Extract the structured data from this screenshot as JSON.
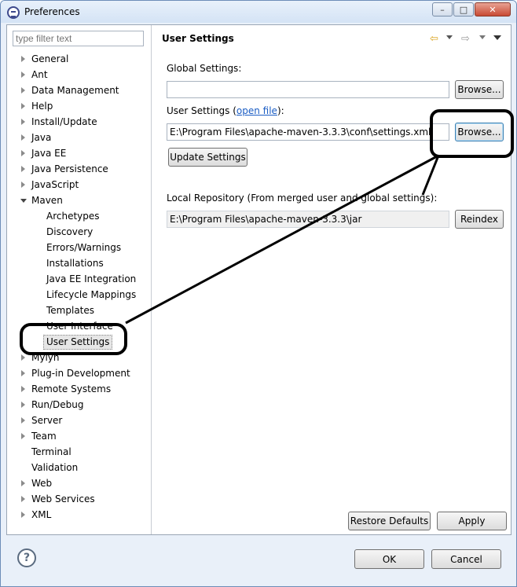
{
  "window": {
    "title": "Preferences",
    "min_glyph": "–",
    "max_glyph": "□",
    "close_glyph": "✕"
  },
  "filter": {
    "placeholder": "type filter text"
  },
  "tree": [
    {
      "label": "General",
      "expandable": true
    },
    {
      "label": "Ant",
      "expandable": true
    },
    {
      "label": "Data Management",
      "expandable": true
    },
    {
      "label": "Help",
      "expandable": true
    },
    {
      "label": "Install/Update",
      "expandable": true
    },
    {
      "label": "Java",
      "expandable": true
    },
    {
      "label": "Java EE",
      "expandable": true
    },
    {
      "label": "Java Persistence",
      "expandable": true
    },
    {
      "label": "JavaScript",
      "expandable": true
    },
    {
      "label": "Maven",
      "expandable": true,
      "expanded": true
    },
    {
      "label": "Archetypes",
      "child": true
    },
    {
      "label": "Discovery",
      "child": true
    },
    {
      "label": "Errors/Warnings",
      "child": true
    },
    {
      "label": "Installations",
      "child": true
    },
    {
      "label": "Java EE Integration",
      "child": true
    },
    {
      "label": "Lifecycle Mappings",
      "child": true
    },
    {
      "label": "Templates",
      "child": true
    },
    {
      "label": "User Interface",
      "child": true
    },
    {
      "label": "User Settings",
      "child": true,
      "selected": true
    },
    {
      "label": "Mylyn",
      "expandable": true
    },
    {
      "label": "Plug-in Development",
      "expandable": true
    },
    {
      "label": "Remote Systems",
      "expandable": true
    },
    {
      "label": "Run/Debug",
      "expandable": true
    },
    {
      "label": "Server",
      "expandable": true
    },
    {
      "label": "Team",
      "expandable": true
    },
    {
      "label": "Terminal",
      "expandable": false
    },
    {
      "label": "Validation",
      "expandable": false
    },
    {
      "label": "Web",
      "expandable": true
    },
    {
      "label": "Web Services",
      "expandable": true
    },
    {
      "label": "XML",
      "expandable": true
    }
  ],
  "page": {
    "title": "User Settings",
    "global_label": "Global Settings:",
    "global_value": "",
    "browse_label": "Browse...",
    "user_label_prefix": "User Settings (",
    "user_label_link": "open file",
    "user_label_suffix": "):",
    "user_value": "E:\\Program Files\\apache-maven-3.3.3\\conf\\settings.xml",
    "browse2_label": "Browse...",
    "update_label": "Update Settings",
    "local_repo_label": "Local Repository (From merged user and global settings):",
    "local_repo_value": "E:\\Program Files\\apache-maven-3.3.3\\jar",
    "reindex_label": "Reindex",
    "restore_label": "Restore Defaults",
    "apply_label": "Apply"
  },
  "footer": {
    "help_glyph": "?",
    "ok_label": "OK",
    "cancel_label": "Cancel"
  },
  "colors": {
    "annotation": "#000000",
    "link": "#1b5dc4",
    "titlebar": "#d4e3f5"
  }
}
